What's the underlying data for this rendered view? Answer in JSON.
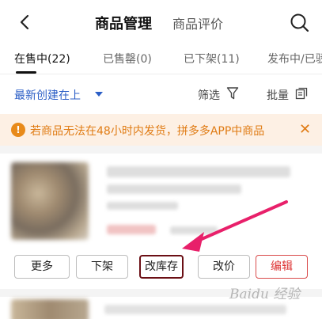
{
  "header": {
    "title": "商品管理",
    "secondary_title": "商品评价",
    "back_icon": "back-chevron-icon",
    "search_icon": "search-icon"
  },
  "tabs": [
    {
      "label": "在售中(22)",
      "active": true
    },
    {
      "label": "已售罄(0)",
      "active": false
    },
    {
      "label": "已下架(11)",
      "active": false
    },
    {
      "label": "发布中/已驳回",
      "active": false
    }
  ],
  "toolbar": {
    "sort_label": "最新创建在上",
    "filter_label": "筛选",
    "batch_label": "批量"
  },
  "notice": {
    "text": "若商品无法在48小时内发货，拼多多APP中商品"
  },
  "actions": {
    "more": "更多",
    "delist": "下架",
    "edit_stock": "改库存",
    "edit_price": "改价",
    "edit": "编辑"
  },
  "watermark": "Baidu 经验",
  "colors": {
    "accent_blue": "#2b5ec6",
    "notice_bg": "#fdf0e4",
    "notice_text": "#e07b13",
    "primary_red": "#d33333",
    "annotation_arrow": "#e8206a",
    "highlight_border": "#6b0f15"
  }
}
